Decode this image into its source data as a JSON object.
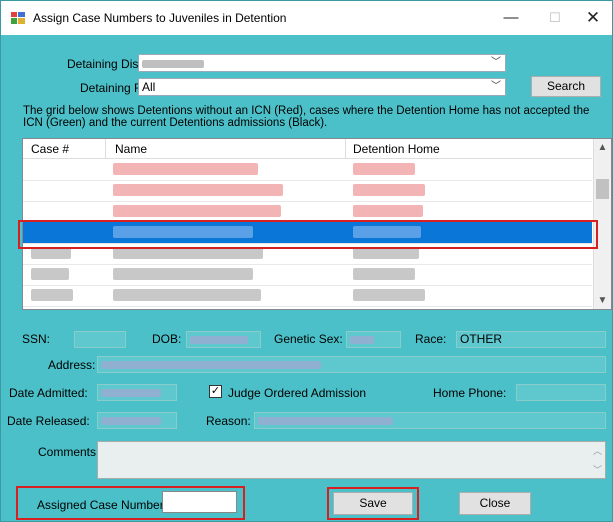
{
  "window": {
    "title": "Assign Case Numbers to Juveniles in Detention",
    "minimize": "—",
    "maximize": "☐",
    "close": "✕"
  },
  "filters": {
    "district_label": "Detaining District:",
    "district_value": "",
    "fips_label": "Detaining FIPS:",
    "fips_value": "All",
    "search_button": "Search"
  },
  "instructions": "The grid below shows Detentions without an ICN (Red), cases where the Detention Home has not accepted the ICN (Green) and the current Detentions admissions (Black).",
  "grid": {
    "columns": [
      "Case #",
      "Name",
      "Detention Home"
    ],
    "rows": [
      {
        "case": "",
        "name": "",
        "home": "",
        "tone": "red"
      },
      {
        "case": "",
        "name": "",
        "home": "",
        "tone": "red"
      },
      {
        "case": "",
        "name": "",
        "home": "",
        "tone": "red"
      },
      {
        "case": "",
        "name": "",
        "home": "",
        "tone": "selected"
      },
      {
        "case": "",
        "name": "",
        "home": "",
        "tone": "black"
      },
      {
        "case": "",
        "name": "",
        "home": "",
        "tone": "black"
      },
      {
        "case": "",
        "name": "",
        "home": "",
        "tone": "black"
      }
    ]
  },
  "details": {
    "ssn_label": "SSN:",
    "dob_label": "DOB:",
    "sex_label": "Genetic Sex:",
    "race_label": "Race:",
    "race_value": "OTHER",
    "address_label": "Address:",
    "date_admitted_label": "Date Admitted:",
    "judge_ordered_label": "Judge Ordered Admission",
    "judge_ordered_checked": "✓",
    "home_phone_label": "Home Phone:",
    "date_released_label": "Date Released:",
    "reason_label": "Reason:",
    "comments_label": "Comments:"
  },
  "footer": {
    "assigned_label": "Assigned Case Number:",
    "assigned_value": "",
    "save_button": "Save",
    "close_button": "Close"
  },
  "colors": {
    "window_bg": "#4bc0c8",
    "selection": "#0a77d8",
    "highlight_box": "#d92020",
    "red_text": "#e57373"
  }
}
